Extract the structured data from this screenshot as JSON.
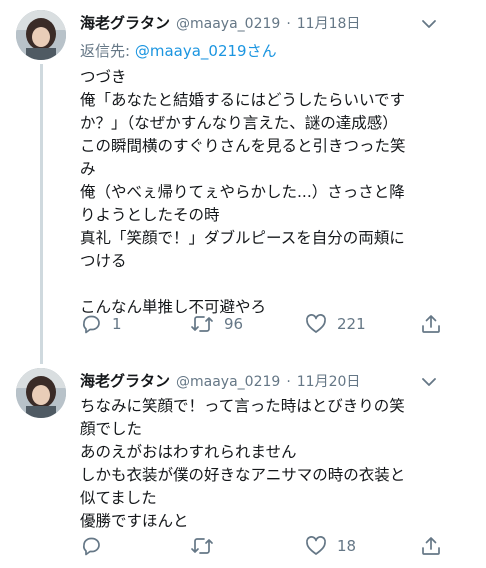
{
  "tweets": [
    {
      "name": "海老グラタン",
      "handle": "@maaya_0219",
      "sep": "·",
      "date": "11月18日",
      "reply_prefix": "返信先:",
      "reply_handle": "@maaya_0219",
      "reply_suffix": "さん",
      "lines": [
        "つづき",
        "俺「あなたと結婚するにはどうしたらいいです",
        "か？」（なぜかすんなり言えた、謎の達成感）",
        "この瞬間横のすぐりさんを見ると引きつった笑",
        "み",
        "俺（やべぇ帰りてぇやらかした...）さっさと降",
        "りようとしたその時",
        "真礼「笑顔で！」ダブルピースを自分の両頬に",
        "つける",
        "",
        "こんなん単推し不可避やろ"
      ],
      "replies": "1",
      "retweets": "96",
      "likes": "221"
    },
    {
      "name": "海老グラタン",
      "handle": "@maaya_0219",
      "sep": "·",
      "date": "11月20日",
      "lines": [
        "ちなみに笑顔で！って言った時はとびきりの笑",
        "顔でした",
        "あのえがおはわすれられません",
        "しかも衣装が僕の好きなアニサマの時の衣装と",
        "似てました",
        "優勝ですほんと"
      ],
      "replies": "",
      "retweets": "",
      "likes": "18"
    }
  ],
  "icons": [
    "avatar",
    "caret-down-icon",
    "reply-icon",
    "retweet-icon",
    "like-icon",
    "share-icon"
  ],
  "colors": {
    "text": "#14171a",
    "muted": "#657786",
    "link": "#1b95e0",
    "thread": "#cfd9de"
  }
}
